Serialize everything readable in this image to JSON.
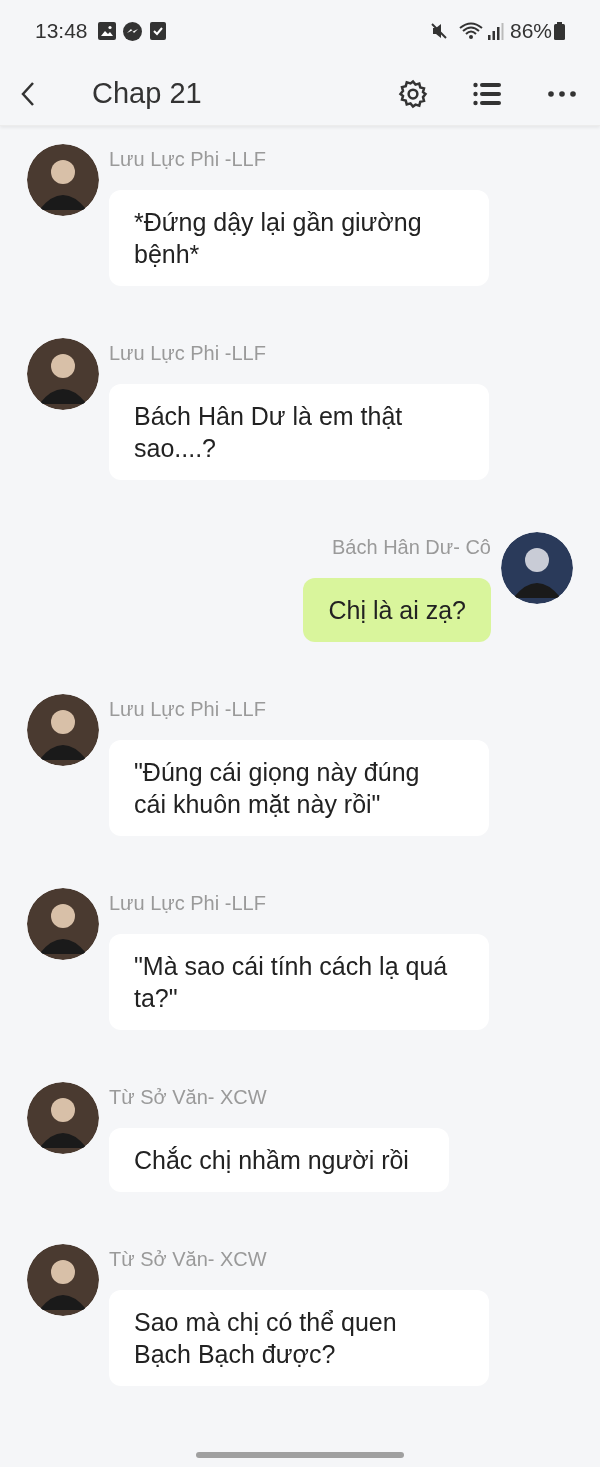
{
  "status_bar": {
    "time": "13:48",
    "battery": "86%"
  },
  "header": {
    "title": "Chap 21"
  },
  "messages": [
    {
      "kind": "left",
      "name": "Lưu Lực Phi -LLF",
      "text": "*Đứng dậy lại gần giường bệnh*"
    },
    {
      "kind": "left",
      "name": "Lưu Lực Phi -LLF",
      "text": "Bách Hân Dư là em thật sao....?"
    },
    {
      "kind": "right",
      "name": "Bách Hân Dư- Cô",
      "text": "Chị là ai zạ?"
    },
    {
      "kind": "left",
      "name": "Lưu Lực Phi -LLF",
      "text": "\"Đúng cái giọng này đúng cái khuôn mặt này rồi\""
    },
    {
      "kind": "left",
      "name": "Lưu Lực Phi -LLF",
      "text": "\"Mà sao cái tính cách lạ quá ta?\""
    },
    {
      "kind": "left",
      "name": "Từ Sở Văn- XCW",
      "text": "Chắc chị nhầm người rồi"
    },
    {
      "kind": "left",
      "name": "Từ Sở Văn- XCW",
      "text": "Sao mà chị có thể quen Bạch Bạch được?"
    }
  ]
}
